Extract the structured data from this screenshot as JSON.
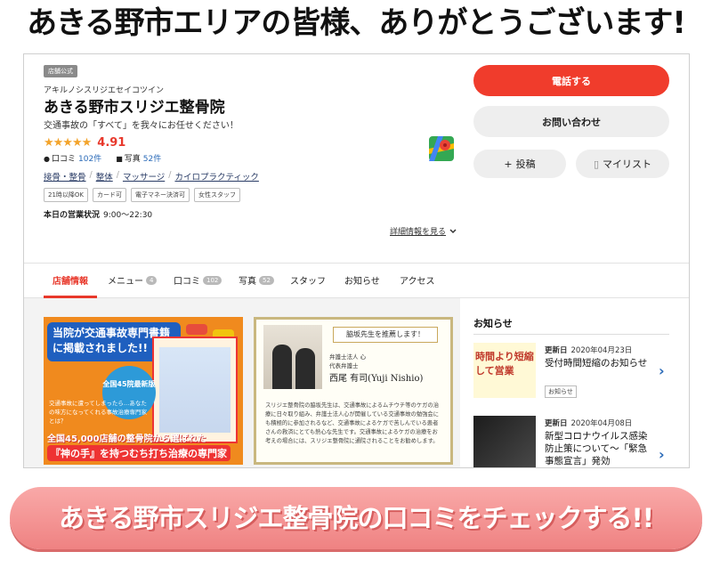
{
  "headline": "あきる野市エリアの皆様、ありがとうございます!",
  "shop": {
    "official_badge": "店舗公式",
    "kana": "アキルノシスリジエセイコツイン",
    "name": "あきる野市スリジエ整骨院",
    "catchphrase": "交通事故の「すべて」を我々にお任せください！",
    "stars": "★★★★★",
    "score": "4.91",
    "review_label": "口コミ",
    "review_count": "102件",
    "photo_label": "写真",
    "photo_count": "52件",
    "categories": [
      "接骨・整骨",
      "整体",
      "マッサージ",
      "カイロプラクティック"
    ],
    "tags": [
      "21時以降OK",
      "カード可",
      "電子マネー決済可",
      "女性スタッフ"
    ],
    "hours_label": "本日の営業状況",
    "hours_value": "9:00～22:30",
    "more_link": "詳細情報を見る"
  },
  "buttons": {
    "call": "電話する",
    "inquiry": "お問い合わせ",
    "post": "投稿",
    "mylist": "マイリスト"
  },
  "tabs": [
    {
      "label": "店舗情報",
      "badge": ""
    },
    {
      "label": "メニュー",
      "badge": "4"
    },
    {
      "label": "口コミ",
      "badge": "102"
    },
    {
      "label": "写真",
      "badge": "52"
    },
    {
      "label": "スタッフ",
      "badge": ""
    },
    {
      "label": "お知らせ",
      "badge": ""
    },
    {
      "label": "アクセス",
      "badge": ""
    }
  ],
  "promo1": {
    "banner": "当院が交通事故専門書籍に掲載されました!!",
    "circle": "全国45院最新版",
    "small": "交通事故に遭ってしまったら…あなたの味方になってくれる事故治療専門家とは？",
    "bottom1": "全国45,000店舗の整骨院から選ばれた",
    "bottom2": "『神の手』を持つむち打ち治療の専門家"
  },
  "promo2": {
    "ribbon": "脇坂先生を推薦します！",
    "title1": "弁護士法人 心",
    "title2": "代表弁護士",
    "name": "西尾 有司(Yuji Nishio)",
    "text": "スリジエ整骨院の脇坂先生は、交通事故によるムチウチ等のケガの治療に日々取り組み、弁護士法人心が開催している交通事故の勉強会にも積極的に参加されるなど、交通事故によるケガで苦しんでいる患者さんの救済にとても熱心な先生です。交通事故によるケガの治療をお考えの場合には、スリジエ整骨院に通院されることをお勧めします。"
  },
  "news": {
    "title": "お知らせ",
    "items": [
      {
        "date_label": "更新日",
        "date": "2020年04月23日",
        "headline": "受付時間短縮のお知らせ",
        "tag": "お知らせ",
        "thumb_text": "時間より短縮して営業"
      },
      {
        "date_label": "更新日",
        "date": "2020年04月08日",
        "headline": "新型コロナウイルス感染防止策について～「緊急事態宣言」発効",
        "tag": "",
        "thumb_text": ""
      }
    ]
  },
  "cta": "あきる野市スリジエ整骨院の口コミをチェックする!!"
}
